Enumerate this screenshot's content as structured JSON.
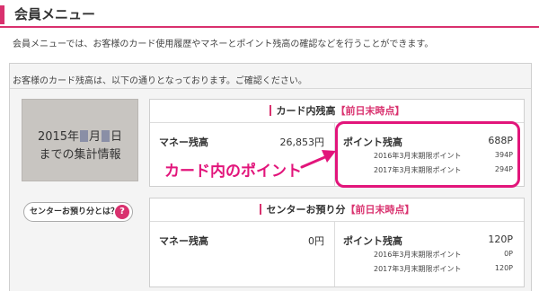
{
  "header": {
    "title": "会員メニュー"
  },
  "intro_text": "会員メニューでは、お客様のカード使用履歴やマネーとポイント残高の確認などを行うことができます。",
  "panel": {
    "intro_text": "お客様のカード残高は、以下の通りとなっております。ご確認ください。",
    "date_box": {
      "year": "2015年",
      "month": "月",
      "day": "日",
      "line2": "までの集計情報"
    },
    "center_button": {
      "label": "センターお預り分とは？",
      "icon": "?"
    }
  },
  "card_section": {
    "title": "カード内残高",
    "title_highlight": "【前日末時点】",
    "money_label": "マネー残高",
    "money_value": "26,853円",
    "points_label": "ポイント残高",
    "points_value": "688P",
    "breakdown": [
      {
        "label": "2016年3月末期限ポイント",
        "value": "394P"
      },
      {
        "label": "2017年3月末期限ポイント",
        "value": "294P"
      }
    ]
  },
  "center_section": {
    "title": "センターお預り分",
    "title_highlight": "【前日末時点】",
    "money_label": "マネー残高",
    "money_value": "0円",
    "points_label": "ポイント残高",
    "points_value": "120P",
    "breakdown": [
      {
        "label": "2016年3月末期限ポイント",
        "value": "0P"
      },
      {
        "label": "2017年3月末期限ポイント",
        "value": "120P"
      }
    ]
  },
  "annotation": {
    "text": "カード内のポイント",
    "color": "#e2157b"
  },
  "colors": {
    "accent": "#d9316e"
  }
}
